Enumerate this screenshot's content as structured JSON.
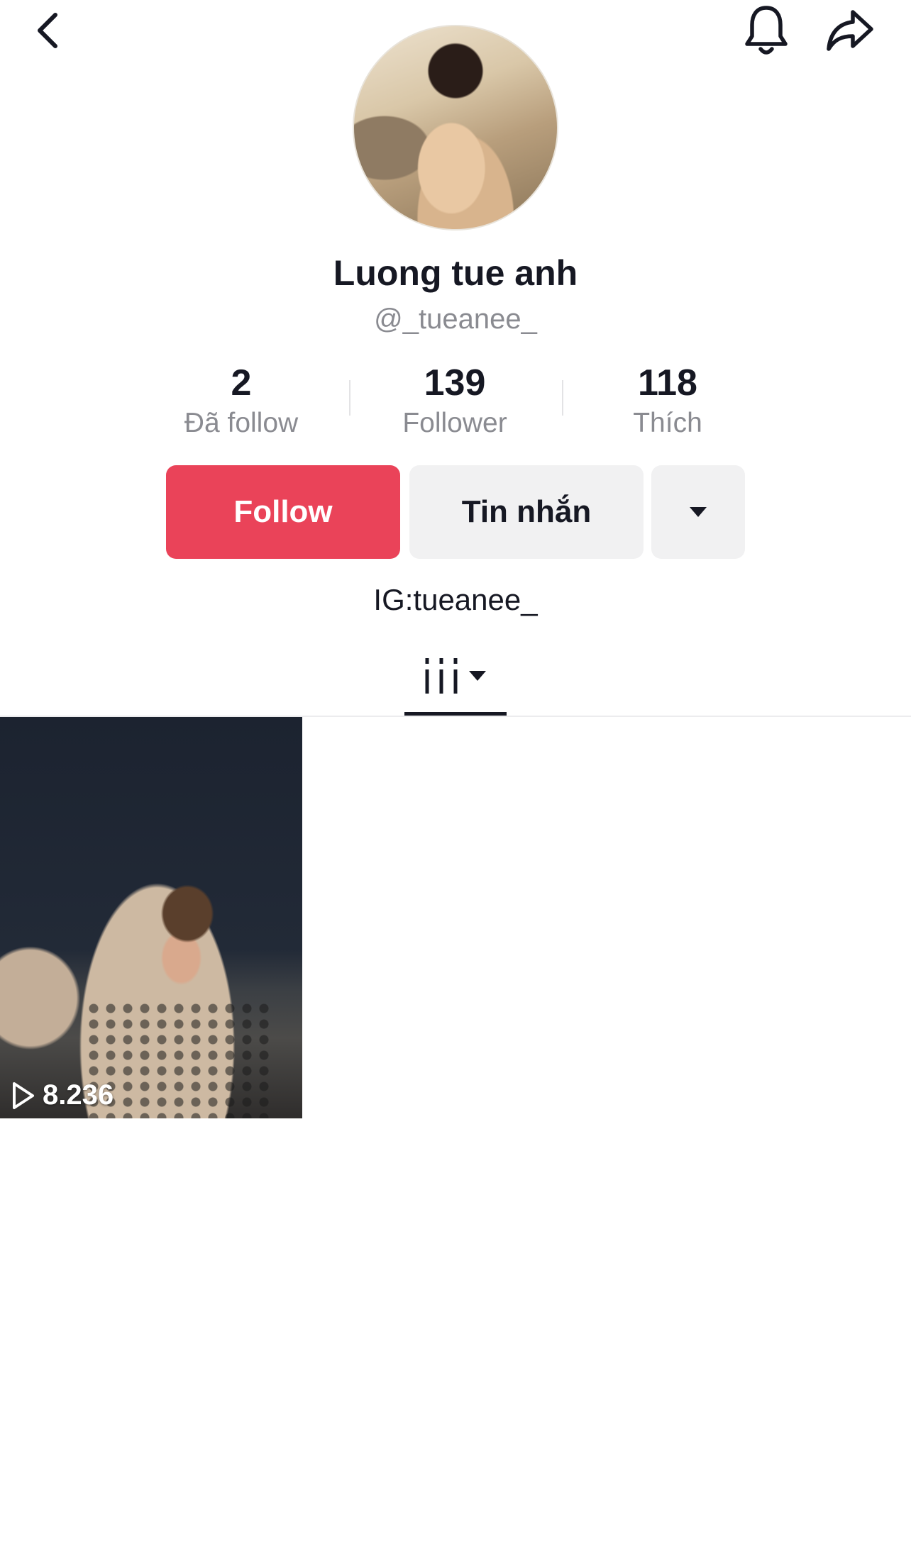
{
  "header": {
    "back_icon": "chevron-left-icon",
    "bell_icon": "bell-icon",
    "share_icon": "share-arrow-icon"
  },
  "profile": {
    "display_name": "Luong tue anh",
    "handle": "@_tueanee_",
    "bio": "IG:tueanee_"
  },
  "stats": {
    "following": {
      "value": "2",
      "label": "Đã follow"
    },
    "followers": {
      "value": "139",
      "label": "Follower"
    },
    "likes": {
      "value": "118",
      "label": "Thích"
    }
  },
  "actions": {
    "follow_label": "Follow",
    "message_label": "Tin nhắn",
    "follow_color": "#ea4359"
  },
  "tabs": {
    "videos_icon": "grid-columns-icon"
  },
  "videos": [
    {
      "play_count": "8.236"
    }
  ]
}
